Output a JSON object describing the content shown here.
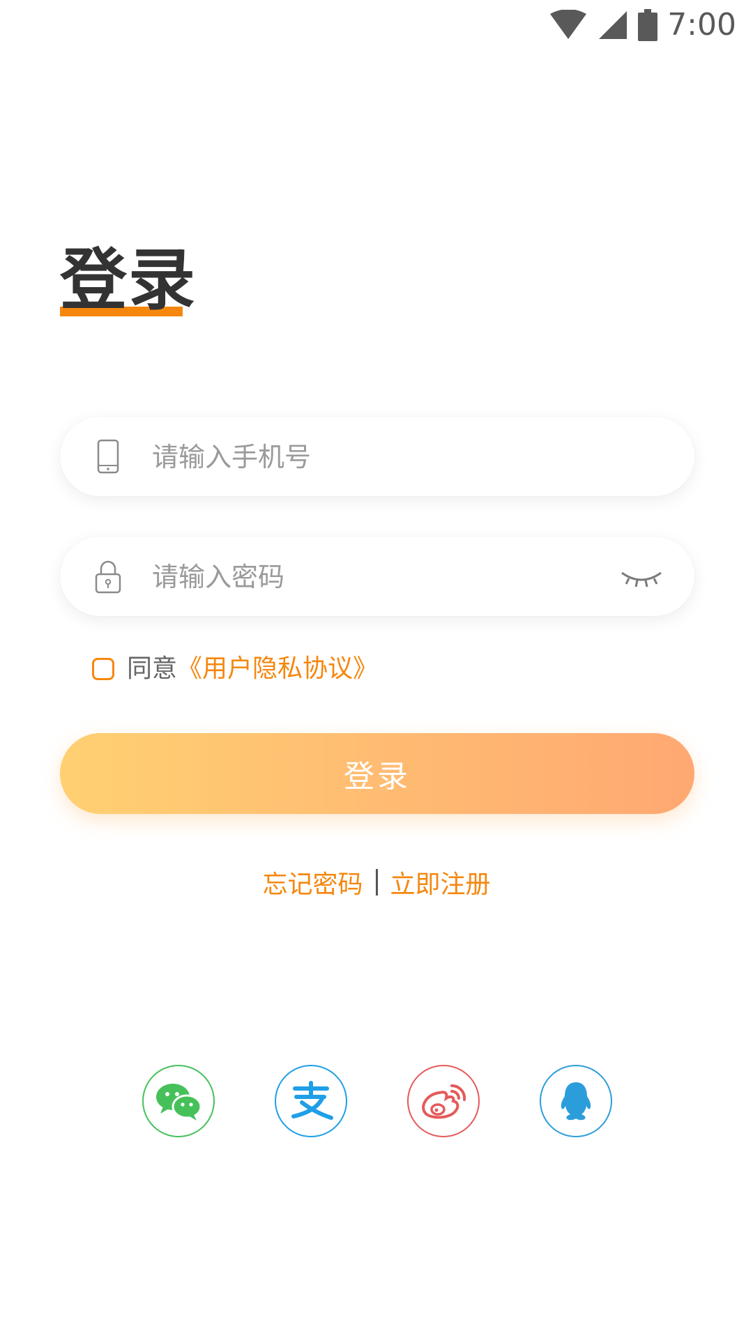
{
  "status_bar": {
    "time": "7:00",
    "icons": [
      "wifi-icon",
      "cell-signal-icon",
      "battery-icon"
    ]
  },
  "login": {
    "title": "登录",
    "phone_placeholder": "请输入手机号",
    "password_placeholder": "请输入密码",
    "agree_prefix": "同意",
    "agree_link": "《用户隐私协议》",
    "submit_label": "登录",
    "forgot_label": "忘记密码",
    "register_label": "立即注册"
  },
  "social_logins": [
    {
      "id": "wechat",
      "icon": "wechat-icon",
      "color": "#46c15a"
    },
    {
      "id": "alipay",
      "icon": "alipay-icon",
      "color": "#1f9fe6"
    },
    {
      "id": "weibo",
      "icon": "weibo-icon",
      "color": "#e55a5a"
    },
    {
      "id": "qq",
      "icon": "qq-icon",
      "color": "#2c9ddb"
    }
  ],
  "colors": {
    "accent": "#f5870f",
    "button_gradient_start": "#ffd072",
    "button_gradient_end": "#ffa872",
    "title_text": "#333333",
    "placeholder_text": "#9a9a9a"
  }
}
